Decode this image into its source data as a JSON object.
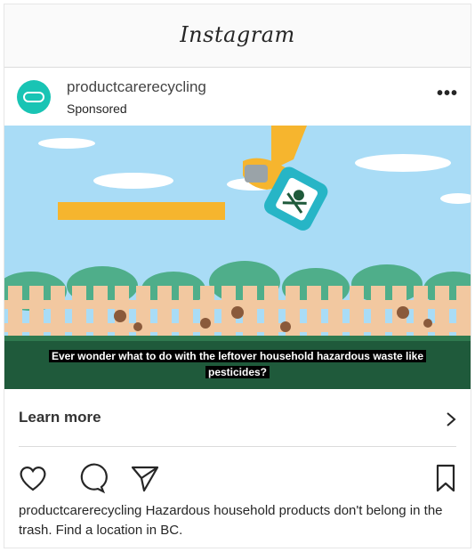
{
  "app": {
    "title": "Instagram"
  },
  "post": {
    "username": "productcarerecycling",
    "sponsored_label": "Sponsored",
    "more_label": "•••",
    "subtitle": "Ever wonder what to do with the leftover household hazardous waste like pesticides?",
    "cta_label": "Learn more",
    "caption_text": "productcarerecycling Hazardous household products don't belong in the trash. Find a location in BC."
  },
  "icons": {
    "more": "more-options-icon",
    "chevron": "chevron-right-icon",
    "like": "heart-icon",
    "comment": "comment-icon",
    "share": "share-icon",
    "save": "bookmark-icon"
  },
  "colors": {
    "sky": "#a9dcf6",
    "grass": "#1f5a3b",
    "fence": "#f2c8a0",
    "bar": "#f6b52e",
    "avatar": "#19c4b4"
  }
}
